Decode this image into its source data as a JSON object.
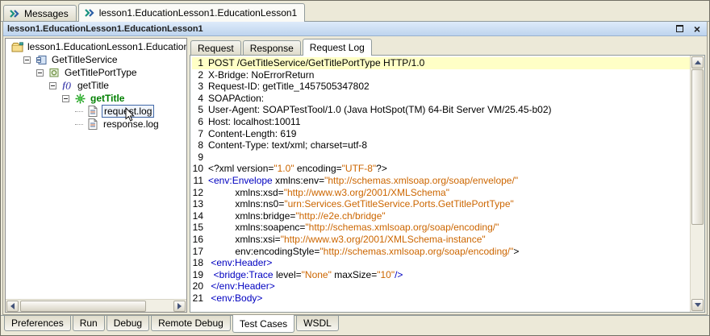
{
  "top_tabs": {
    "items": [
      {
        "id": "messages",
        "label": "Messages",
        "icon": "test-suite-icon",
        "active": false
      },
      {
        "id": "lesson1-educationlesson1",
        "label": "lesson1.EducationLesson1.EducationLesson1",
        "icon": "test-suite-icon",
        "active": true
      }
    ]
  },
  "frame": {
    "title": "lesson1.EducationLesson1.EducationLesson1",
    "close_glyph": "×"
  },
  "tree": {
    "nodes": [
      {
        "label": "lesson1.EducationLesson1.Education",
        "depth": 0,
        "icon": "package-icon",
        "expander": false,
        "leaf": false
      },
      {
        "label": "GetTitleService",
        "depth": 1,
        "icon": "service-icon",
        "expander": true,
        "leaf": false
      },
      {
        "label": "GetTitlePortType",
        "depth": 2,
        "icon": "porttype-icon",
        "expander": true,
        "leaf": false
      },
      {
        "label": "getTitle",
        "depth": 3,
        "icon": "function-icon",
        "expander": true,
        "leaf": false
      },
      {
        "label": "getTitle",
        "depth": 4,
        "icon": "operation-icon",
        "expander": true,
        "leaf": false,
        "color": "#007F00",
        "bold": true
      },
      {
        "label": "request.log",
        "depth": 5,
        "icon": "logfile-icon",
        "expander": false,
        "leaf": true,
        "selected": true
      },
      {
        "label": "response.log",
        "depth": 5,
        "icon": "logfile-icon",
        "expander": false,
        "leaf": true
      }
    ]
  },
  "detail": {
    "tabs": [
      {
        "label": "Request",
        "active": false
      },
      {
        "label": "Response",
        "active": false
      },
      {
        "label": "Request Log",
        "active": true
      }
    ]
  },
  "log": {
    "lines": [
      {
        "n": 1,
        "hl": true,
        "seg": [
          [
            "p",
            "POST /GetTitleService/GetTitlePortType HTTP/1.0"
          ]
        ]
      },
      {
        "n": 2,
        "seg": [
          [
            "p",
            "X-Bridge: NoErrorReturn"
          ]
        ]
      },
      {
        "n": 3,
        "seg": [
          [
            "p",
            "Request-ID: getTitle_1457505347802"
          ]
        ]
      },
      {
        "n": 4,
        "seg": [
          [
            "p",
            "SOAPAction:"
          ]
        ]
      },
      {
        "n": 5,
        "seg": [
          [
            "p",
            "User-Agent: SOAPTestTool/1.0 (Java HotSpot(TM) 64-Bit Server VM/25.45-b02)"
          ]
        ]
      },
      {
        "n": 6,
        "seg": [
          [
            "p",
            "Host: localhost:10011"
          ]
        ]
      },
      {
        "n": 7,
        "seg": [
          [
            "p",
            "Content-Length: 619"
          ]
        ]
      },
      {
        "n": 8,
        "seg": [
          [
            "p",
            "Content-Type: text/xml; charset=utf-8"
          ]
        ]
      },
      {
        "n": 9,
        "seg": []
      },
      {
        "n": 10,
        "seg": [
          [
            "p",
            "<?xml version="
          ],
          [
            "v",
            "\"1.0\""
          ],
          [
            "p",
            " encoding="
          ],
          [
            "v",
            "\"UTF-8\""
          ],
          [
            "p",
            "?>"
          ]
        ]
      },
      {
        "n": 11,
        "seg": [
          [
            "t",
            "<env:Envelope"
          ],
          [
            "p",
            " xmlns:env="
          ],
          [
            "v",
            "\"http://schemas.xmlsoap.org/soap/envelope/\""
          ]
        ]
      },
      {
        "n": 12,
        "seg": [
          [
            "p",
            "          xmlns:xsd="
          ],
          [
            "v",
            "\"http://www.w3.org/2001/XMLSchema\""
          ]
        ]
      },
      {
        "n": 13,
        "seg": [
          [
            "p",
            "          xmlns:ns0="
          ],
          [
            "v",
            "\"urn:Services.GetTitleService.Ports.GetTitlePortType\""
          ]
        ]
      },
      {
        "n": 14,
        "seg": [
          [
            "p",
            "          xmlns:bridge="
          ],
          [
            "v",
            "\"http://e2e.ch/bridge\""
          ]
        ]
      },
      {
        "n": 15,
        "seg": [
          [
            "p",
            "          xmlns:soapenc="
          ],
          [
            "v",
            "\"http://schemas.xmlsoap.org/soap/encoding/\""
          ]
        ]
      },
      {
        "n": 16,
        "seg": [
          [
            "p",
            "          xmlns:xsi="
          ],
          [
            "v",
            "\"http://www.w3.org/2001/XMLSchema-instance\""
          ]
        ]
      },
      {
        "n": 17,
        "seg": [
          [
            "p",
            "          env:encodingStyle="
          ],
          [
            "v",
            "\"http://schemas.xmlsoap.org/soap/encoding/\""
          ],
          [
            "p",
            ">"
          ]
        ]
      },
      {
        "n": 18,
        "seg": [
          [
            "t",
            " <env:Header>"
          ]
        ]
      },
      {
        "n": 19,
        "seg": [
          [
            "p",
            "  "
          ],
          [
            "t",
            "<bridge:Trace"
          ],
          [
            "p",
            " level="
          ],
          [
            "v",
            "\"None\""
          ],
          [
            "p",
            " maxSize="
          ],
          [
            "v",
            "\"10\""
          ],
          [
            "t",
            "/>"
          ]
        ]
      },
      {
        "n": 20,
        "seg": [
          [
            "t",
            " </env:Header>"
          ]
        ]
      },
      {
        "n": 21,
        "seg": [
          [
            "t",
            " <env:Body>"
          ]
        ]
      }
    ]
  },
  "bottom_tabs": {
    "items": [
      {
        "label": "Preferences",
        "active": false
      },
      {
        "label": "Run",
        "active": false
      },
      {
        "label": "Debug",
        "active": false
      },
      {
        "label": "Remote Debug",
        "active": false
      },
      {
        "label": "Test Cases",
        "active": true
      },
      {
        "label": "WSDL",
        "active": false
      }
    ]
  },
  "colors": {
    "syntax_tag": "#0000C0",
    "syntax_value": "#CC6600",
    "syntax_plain": "#000000",
    "current_line_highlight": "#FFFFC6",
    "selection_border": "#4168A8",
    "titlebar_top": "#DEEBFA",
    "titlebar_bottom": "#BDD4EE"
  }
}
